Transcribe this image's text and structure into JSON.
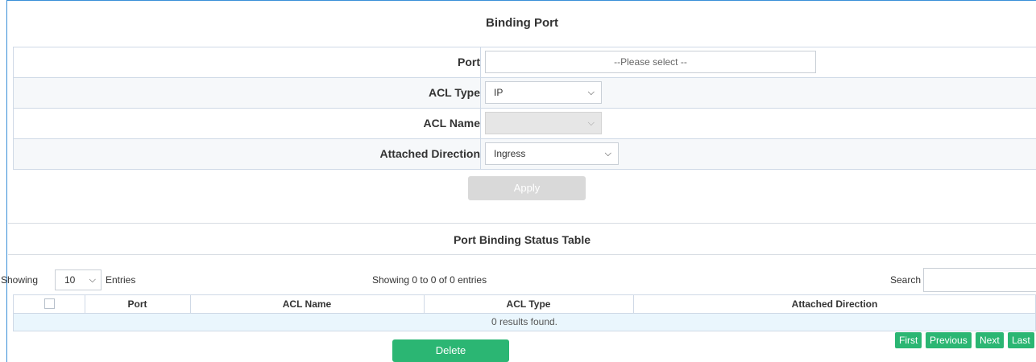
{
  "binding_port": {
    "title": "Binding Port",
    "rows": [
      {
        "label": "Port",
        "value": "--Please select --"
      },
      {
        "label": "ACL Type",
        "value": "IP"
      },
      {
        "label": "ACL Name",
        "value": ""
      },
      {
        "label": "Attached Direction",
        "value": "Ingress"
      }
    ],
    "apply_label": "Apply"
  },
  "status_table": {
    "title": "Port Binding Status Table",
    "showing_label": "Showing",
    "page_length": "10",
    "entries_label": "Entries",
    "info": "Showing 0 to 0 of 0 entries",
    "search_label": "Search",
    "search_value": "",
    "columns": [
      "Port",
      "ACL Name",
      "ACL Type",
      "Attached Direction"
    ],
    "empty_message": "0 results found.",
    "pagination": [
      "First",
      "Previous",
      "Next",
      "Last"
    ],
    "delete_label": "Delete"
  },
  "colors": {
    "accent_green": "#2bb673",
    "frame_blue": "#3a8fd8",
    "empty_row_bg": "#eaf6fd",
    "disabled_gray": "#d9d9d9"
  },
  "icons": {
    "dropdown": "chevron-down-icon",
    "checkbox": "select-all-checkbox"
  }
}
